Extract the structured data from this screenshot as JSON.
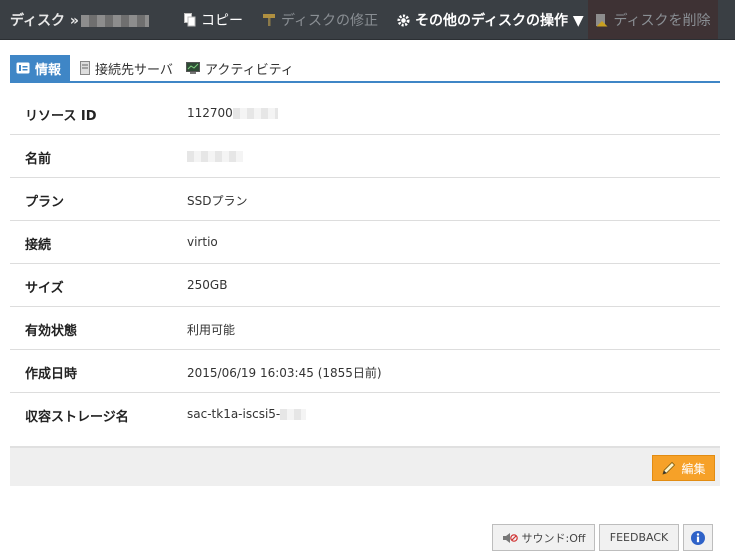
{
  "topbar": {
    "title": "ディスク »",
    "copy_label": "コピー",
    "modify_label": "ディスクの修正",
    "other_label": "その他のディスクの操作 ▼",
    "delete_label": "ディスクを削除"
  },
  "tabs": [
    {
      "label": "情報",
      "icon": "info-card-icon",
      "active": true
    },
    {
      "label": "接続先サーバ",
      "icon": "server-icon",
      "active": false
    },
    {
      "label": "アクティビティ",
      "icon": "monitor-icon",
      "active": false
    }
  ],
  "info": {
    "rows": [
      {
        "key": "リソース ID",
        "value": "112700"
      },
      {
        "key": "名前",
        "value": ""
      },
      {
        "key": "プラン",
        "value": "SSDプラン"
      },
      {
        "key": "接続",
        "value": "virtio"
      },
      {
        "key": "サイズ",
        "value": "250GB"
      },
      {
        "key": "有効状態",
        "value": "利用可能"
      },
      {
        "key": "作成日時",
        "value": "2015/06/19 16:03:45 (1855日前)"
      },
      {
        "key": "収容ストレージ名",
        "value": "sac-tk1a-iscsi5-"
      }
    ]
  },
  "actions": {
    "edit_label": "編集"
  },
  "footer": {
    "sound_label": "サウンド:Off",
    "feedback_label": "FEEDBACK"
  },
  "colors": {
    "topbar_bg": "#3a3f44",
    "tab_accent": "#3f86c6",
    "edit_button": "#f6a128"
  }
}
